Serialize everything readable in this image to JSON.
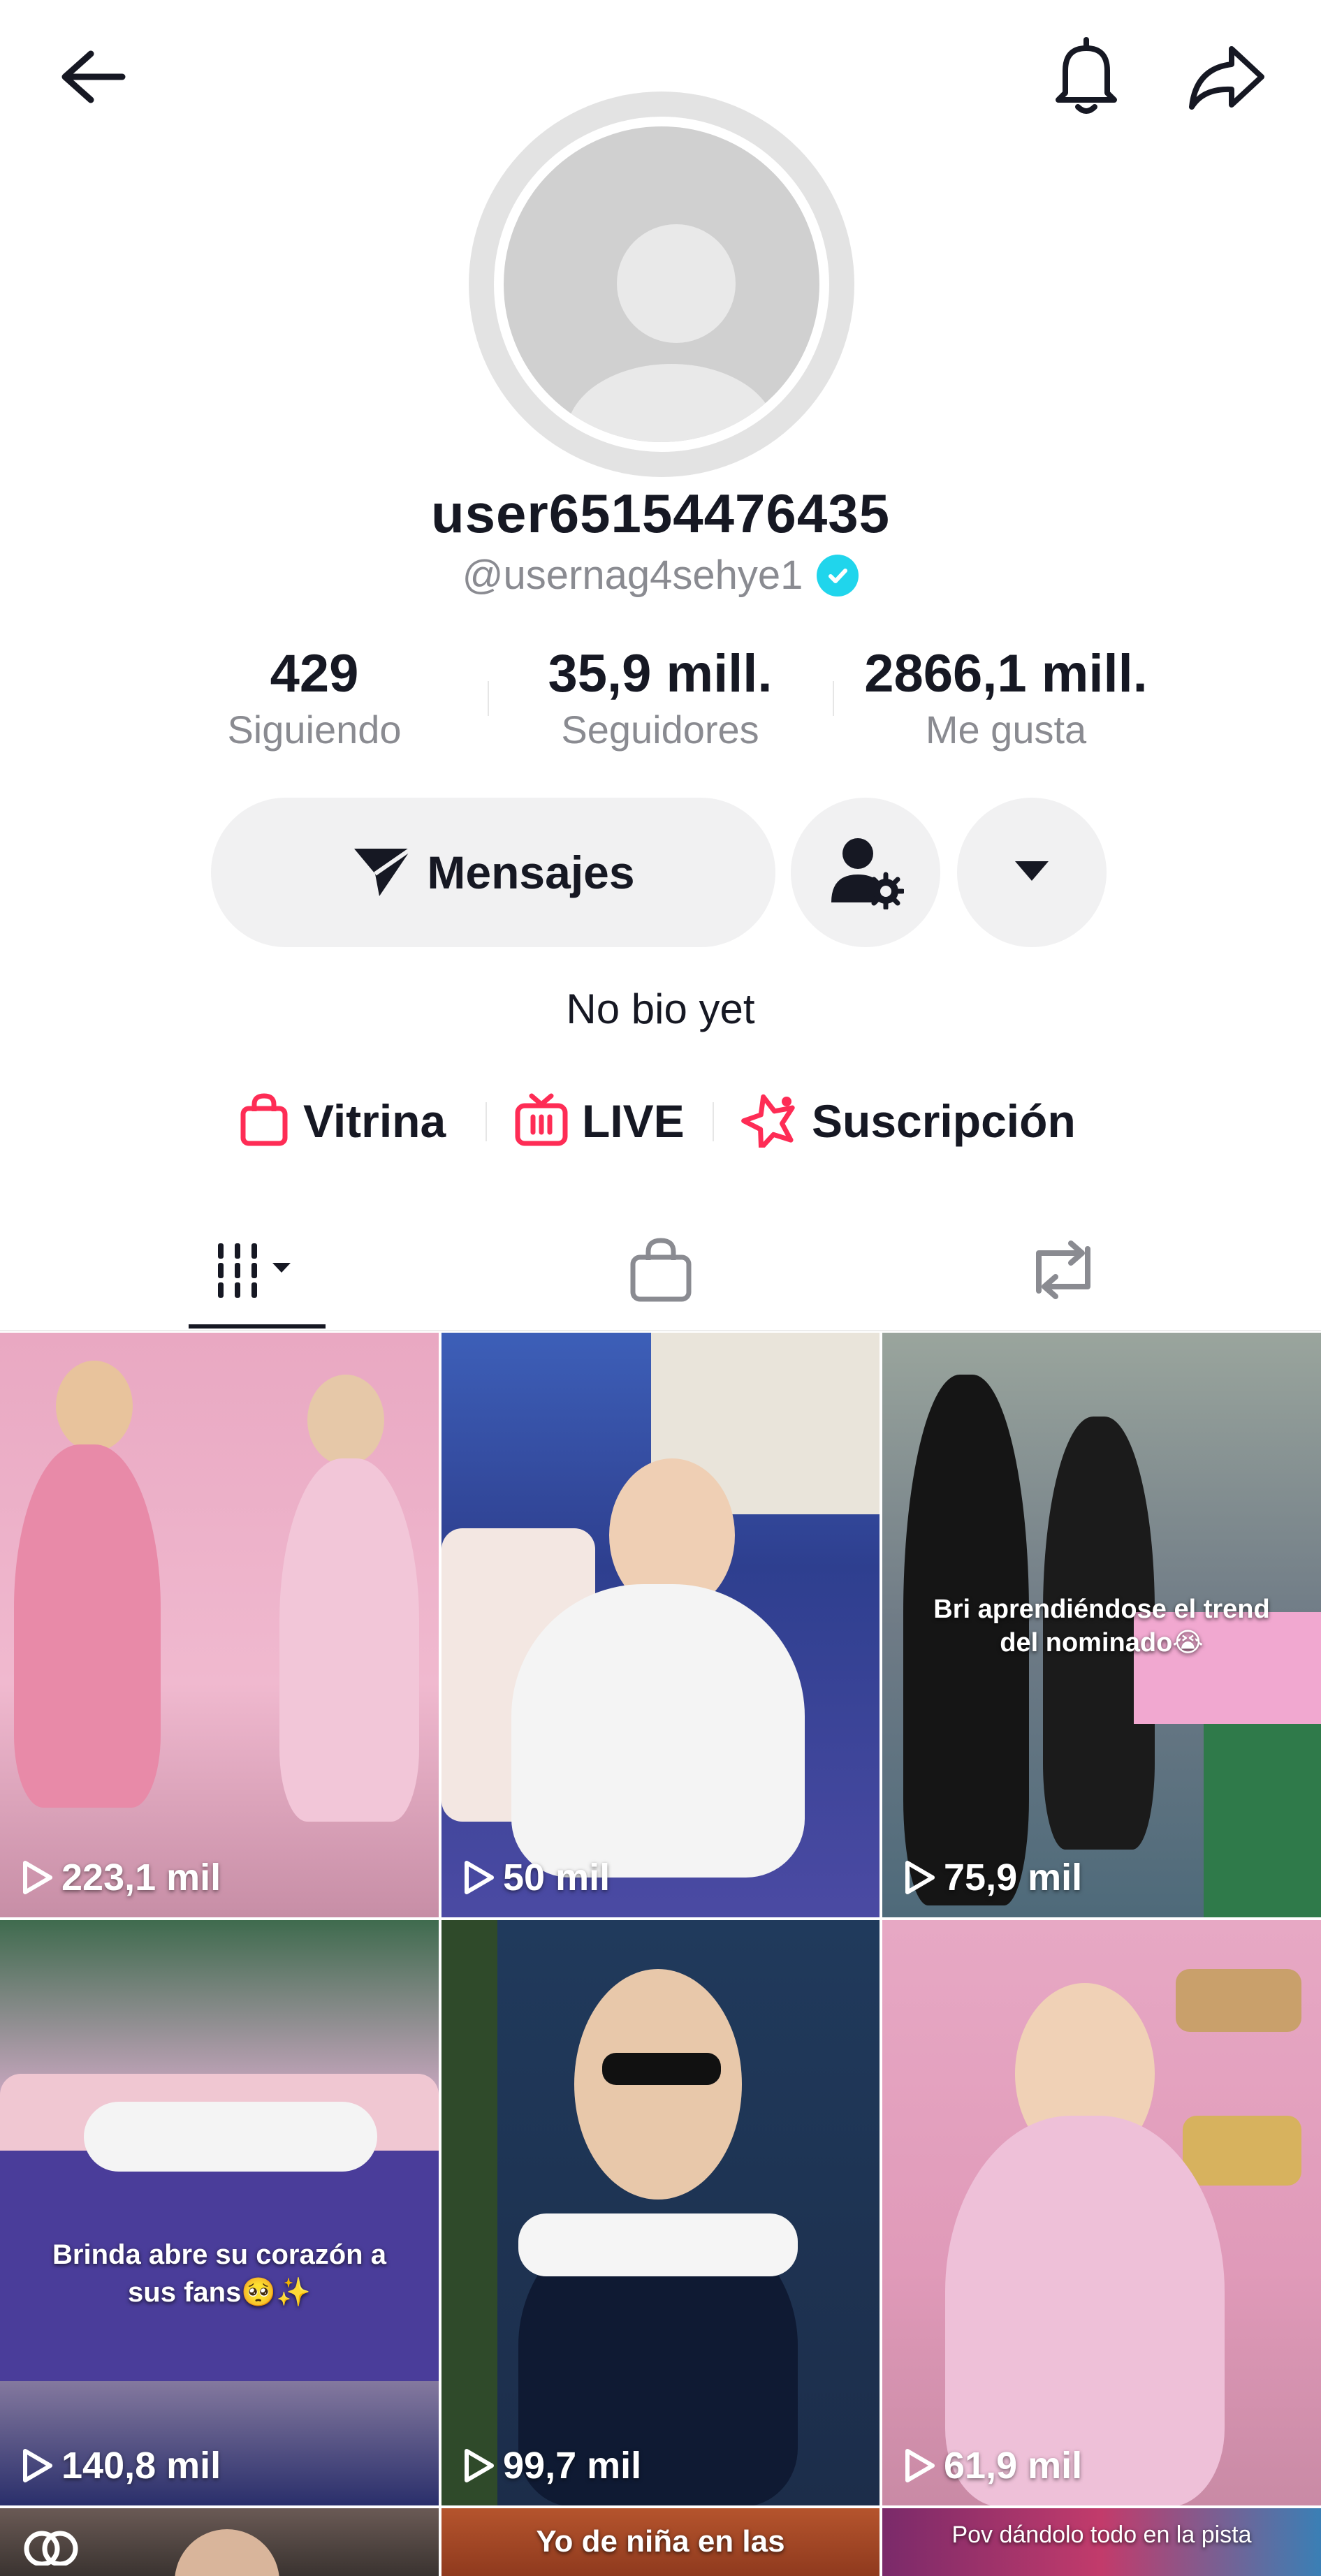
{
  "header": {
    "back_icon": "arrow-left-icon",
    "bell_icon": "bell-icon",
    "share_icon": "share-arrow-icon"
  },
  "profile": {
    "display_name": "user65154476435",
    "handle": "@usernag4sehye1",
    "verified": true,
    "stats": [
      {
        "value": "429",
        "label": "Siguiendo"
      },
      {
        "value": "35,9 mill.",
        "label": "Seguidores"
      },
      {
        "value": "2866,1 mill.",
        "label": "Me gusta"
      }
    ],
    "bio": "No bio yet"
  },
  "actions": {
    "message_label": "Mensajes",
    "message_icon": "send-icon",
    "friends_icon": "user-settings-icon",
    "more_icon": "caret-down-icon"
  },
  "links": [
    {
      "label": "Vitrina",
      "icon": "shopping-bag-icon"
    },
    {
      "label": "LIVE",
      "icon": "live-tv-icon"
    },
    {
      "label": "Suscripción",
      "icon": "star-subscription-icon"
    }
  ],
  "tabs": [
    {
      "name": "videos",
      "icon": "grid-icon",
      "selected": true
    },
    {
      "name": "shop",
      "icon": "shopping-bag-icon",
      "selected": false
    },
    {
      "name": "reposts",
      "icon": "repost-icon",
      "selected": false
    }
  ],
  "videos": [
    {
      "views": "223,1 mil",
      "caption": ""
    },
    {
      "views": "50 mil",
      "caption": ""
    },
    {
      "views": "75,9 mil",
      "caption": "Bri aprendiéndose el trend del nominado😭"
    },
    {
      "views": "140,8 mil",
      "caption": "Brinda abre su corazón a sus fans🥺✨"
    },
    {
      "views": "99,7 mil",
      "caption": ""
    },
    {
      "views": "61,9 mil",
      "caption": ""
    },
    {
      "views": "",
      "caption": ""
    },
    {
      "views": "",
      "caption": "Yo de niña en las"
    },
    {
      "views": "",
      "caption": "Pov dándolo todo en la pista"
    }
  ],
  "colors": {
    "accent_pink": "#fe2c55",
    "text_primary": "#161823",
    "text_secondary": "#8a8b91",
    "button_bg": "#f1f1f2",
    "verified_blue": "#20d5ec"
  }
}
